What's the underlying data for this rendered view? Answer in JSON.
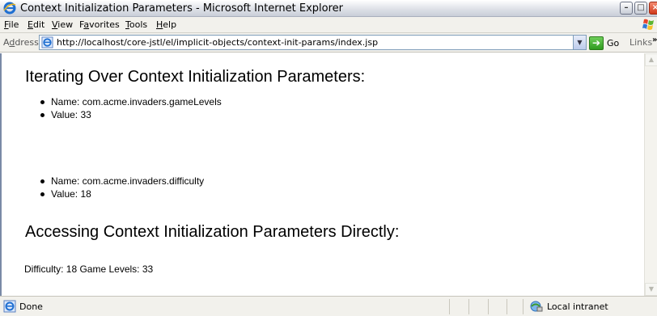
{
  "window": {
    "title": "Context Initialization Parameters - Microsoft Internet Explorer",
    "icons": {
      "app": "ie-icon",
      "minimize": "minimize-icon",
      "maximize": "maximize-icon",
      "close": "close-icon"
    }
  },
  "menubar": {
    "items": [
      {
        "label": "File",
        "mnemonic": "F",
        "rest": "ile"
      },
      {
        "label": "Edit",
        "mnemonic": "E",
        "rest": "dit"
      },
      {
        "label": "View",
        "mnemonic": "V",
        "rest": "iew"
      },
      {
        "label": "Favorites",
        "pre": "F",
        "mnemonic": "a",
        "rest": "vorites"
      },
      {
        "label": "Tools",
        "mnemonic": "T",
        "rest": "ools"
      },
      {
        "label": "Help",
        "mnemonic": "H",
        "rest": "elp"
      }
    ]
  },
  "addressbar": {
    "label_pre": "A",
    "label_mnemonic": "d",
    "label_rest": "dress",
    "url": "http://localhost/core-jstl/el/implicit-objects/context-init-params/index.jsp",
    "go_label": "Go",
    "links_label": "Links",
    "links_chevron": "»"
  },
  "content": {
    "heading1": "Iterating Over Context Initialization Parameters:",
    "params": [
      {
        "name_line": "Name: com.acme.invaders.gameLevels",
        "value_line": "Value: 33"
      },
      {
        "name_line": "Name: com.acme.invaders.difficulty",
        "value_line": "Value: 18"
      }
    ],
    "heading2": "Accessing Context Initialization Parameters Directly:",
    "direct_line": "Difficulty: 18 Game Levels: 33"
  },
  "statusbar": {
    "status": "Done",
    "zone": "Local intranet"
  }
}
